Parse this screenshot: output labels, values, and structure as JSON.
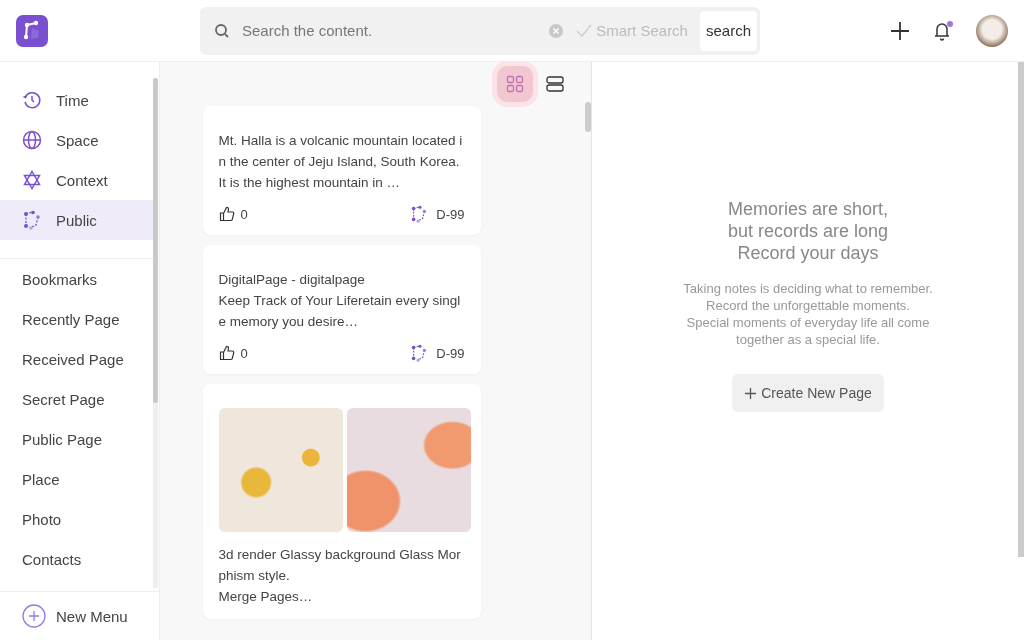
{
  "header": {
    "search": {
      "placeholder": "Search the content.",
      "smart_search": "Smart Search",
      "button": "search"
    },
    "notification_unread": true
  },
  "sidebar": {
    "items": [
      {
        "label": "Time",
        "kind": "clock",
        "selected": false
      },
      {
        "label": "Space",
        "kind": "globe",
        "selected": false
      },
      {
        "label": "Context",
        "kind": "context",
        "selected": false
      },
      {
        "label": "Public",
        "kind": "public",
        "selected": true
      }
    ],
    "pages": [
      "Bookmarks",
      "Recently Page",
      "Received Page",
      "Secret Page",
      "Public Page",
      "Place",
      "Photo",
      "Contacts"
    ],
    "new_menu": "New Menu"
  },
  "view_modes": [
    {
      "kind": "grid",
      "selected": true
    },
    {
      "kind": "list",
      "selected": false
    }
  ],
  "cards": [
    {
      "kind": "text",
      "lines": [
        "Mt. Halla is a volcanic mountain located in the center of Jeju Island, South Korea. It is the highest mountain in …"
      ],
      "likes": "0",
      "tag": "D-99"
    },
    {
      "kind": "text",
      "lines": [
        "DigitalPage - digitalpage",
        "Keep Track of Your Liferetain every single memory you desire…"
      ],
      "likes": "0",
      "tag": "D-99"
    },
    {
      "kind": "images",
      "lines": [
        "3d render Glassy background Glass Morphism style.",
        "Merge Pages…"
      ]
    }
  ],
  "empty_state": {
    "headline": [
      "Memories are short,",
      "but records are long",
      "Record your days"
    ],
    "body": [
      "Taking notes is deciding what to remember.",
      "Record the unforgettable moments.",
      "Special moments of everyday life all come",
      "together as a special life."
    ],
    "button": "Create New Page"
  }
}
